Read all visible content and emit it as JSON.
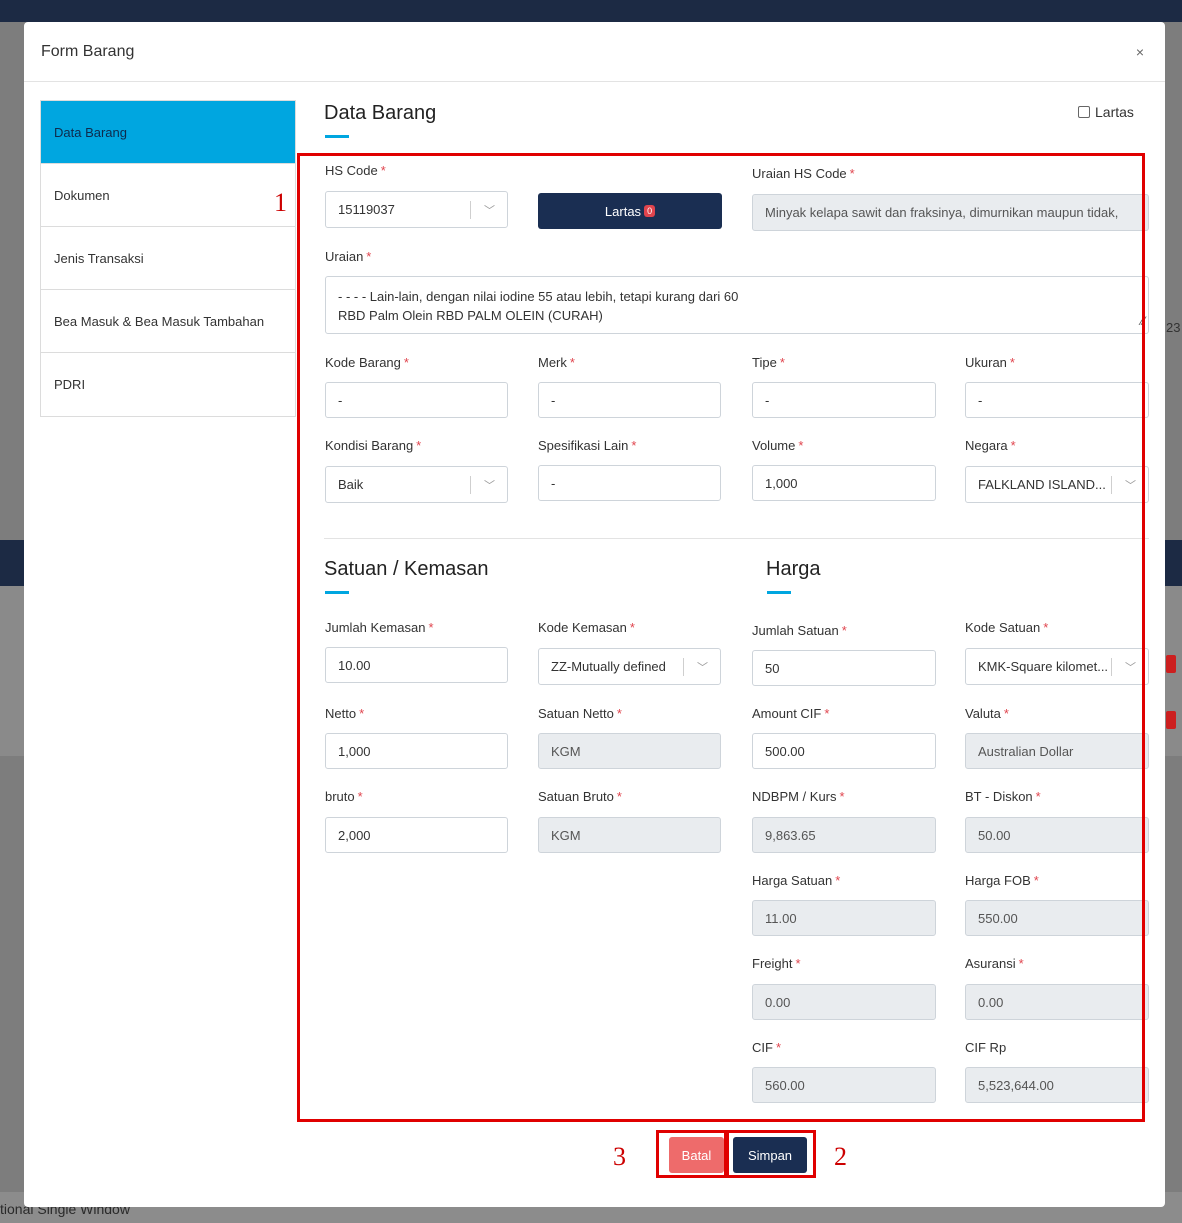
{
  "modal": {
    "title": "Form Barang",
    "close": "×"
  },
  "nav": [
    "Data Barang",
    "Dokumen",
    "Jenis Transaksi",
    "Bea Masuk & Bea Masuk Tambahan",
    "PDRI"
  ],
  "section": {
    "data_barang": "Data Barang",
    "satuan": "Satuan / Kemasan",
    "harga": "Harga",
    "lartas_checkbox": "Lartas"
  },
  "hs": {
    "label": "HS Code",
    "value": "15119037",
    "lartas_button": "Lartas",
    "lartas_count": "0",
    "uraian_hs_label": "Uraian HS Code",
    "uraian_hs_value": "Minyak kelapa sawit dan fraksinya, dimurnikan maupun tidak,"
  },
  "uraian": {
    "label": "Uraian",
    "line1": "- - - - Lain-lain, dengan nilai iodine 55 atau lebih, tetapi kurang dari 60",
    "line2": "RBD Palm Olein RBD PALM OLEIN (CURAH)"
  },
  "row1": {
    "kode_barang": {
      "label": "Kode Barang",
      "value": "-"
    },
    "merk": {
      "label": "Merk",
      "value": "-"
    },
    "tipe": {
      "label": "Tipe",
      "value": "-"
    },
    "ukuran": {
      "label": "Ukuran",
      "value": "-"
    }
  },
  "row2": {
    "kondisi": {
      "label": "Kondisi Barang",
      "value": "Baik"
    },
    "spesifikasi": {
      "label": "Spesifikasi Lain",
      "value": "-"
    },
    "volume": {
      "label": "Volume",
      "value": "1,000"
    },
    "negara": {
      "label": "Negara",
      "value": "FALKLAND ISLAND..."
    }
  },
  "kemasan": {
    "jumlah_kemasan": {
      "label": "Jumlah Kemasan",
      "value": "10.00"
    },
    "kode_kemasan": {
      "label": "Kode Kemasan",
      "value": "ZZ-Mutually defined"
    },
    "netto": {
      "label": "Netto",
      "value": "1,000"
    },
    "satuan_netto": {
      "label": "Satuan Netto",
      "value": "KGM"
    },
    "bruto": {
      "label": "bruto",
      "value": "2,000"
    },
    "satuan_bruto": {
      "label": "Satuan Bruto",
      "value": "KGM"
    }
  },
  "harga": {
    "jumlah_satuan": {
      "label": "Jumlah Satuan",
      "value": "50"
    },
    "kode_satuan": {
      "label": "Kode Satuan",
      "value": "KMK-Square kilomet..."
    },
    "amount_cif": {
      "label": "Amount CIF",
      "value": "500.00"
    },
    "valuta": {
      "label": "Valuta",
      "value": "Australian Dollar"
    },
    "ndbpm": {
      "label": "NDBPM / Kurs",
      "value": "9,863.65"
    },
    "bt_diskon": {
      "label": "BT - Diskon",
      "value": "50.00"
    },
    "harga_satuan": {
      "label": "Harga Satuan",
      "value": "11.00"
    },
    "harga_fob": {
      "label": "Harga FOB",
      "value": "550.00"
    },
    "freight": {
      "label": "Freight",
      "value": "0.00"
    },
    "asuransi": {
      "label": "Asuransi",
      "value": "0.00"
    },
    "cif": {
      "label": "CIF",
      "value": "560.00"
    },
    "cif_rp": {
      "label": "CIF Rp",
      "value": "5,523,644.00"
    }
  },
  "required_mark": "*",
  "buttons": {
    "batal": "Batal",
    "simpan": "Simpan"
  },
  "annotations": {
    "a1": "1",
    "a2": "2",
    "a3": "3"
  },
  "background": {
    "footer": "tional Single Window",
    "side_fragment": "23"
  }
}
